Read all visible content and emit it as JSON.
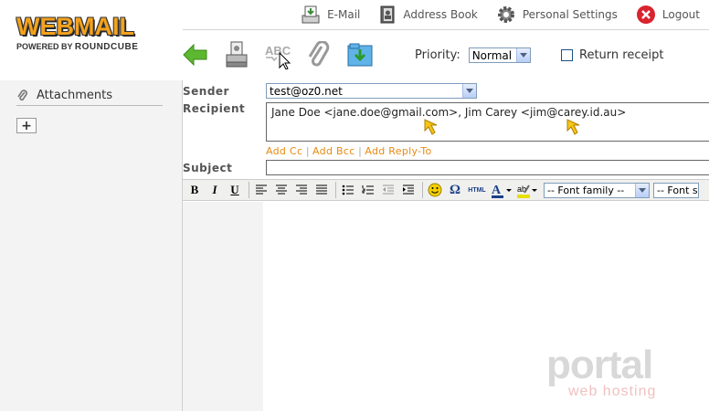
{
  "logo": {
    "title": "WEBMAIL",
    "powered_by": "POWERED BY",
    "brand": "ROUNDCUBE"
  },
  "topnav": [
    {
      "label": "E-Mail",
      "icon": "email-icon"
    },
    {
      "label": "Address Book",
      "icon": "address-book-icon"
    },
    {
      "label": "Personal Settings",
      "icon": "gear-icon"
    },
    {
      "label": "Logout",
      "icon": "logout-icon"
    }
  ],
  "toolbar": {
    "buttons": [
      "back-icon",
      "send-icon",
      "spellcheck-icon",
      "attach-icon",
      "save-icon"
    ],
    "spellcheck_text": "ABC",
    "priority_label": "Priority:",
    "priority_value": "Normal",
    "receipt_label": "Return receipt"
  },
  "sidebar": {
    "attachments_label": "Attachments",
    "add_label": "+"
  },
  "compose": {
    "sender_label": "Sender",
    "sender_value": "test@oz0.net",
    "recipient_label": "Recipient",
    "recipient_value": "Jane Doe <jane.doe@gmail.com>, Jim Carey <jim@carey.id.au>",
    "add_cc": "Add Cc",
    "add_bcc": "Add Bcc",
    "add_reply_to": "Add Reply-To",
    "separator": "|",
    "subject_label": "Subject",
    "subject_value": ""
  },
  "editor": {
    "bold": "B",
    "italic": "I",
    "underline": "U",
    "html_label": "HTML",
    "font_family": "-- Font family --",
    "font_size": "-- Font s"
  },
  "watermark": {
    "line1": "portal",
    "line2": "web hosting"
  },
  "colors": {
    "accent_orange": "#e88a12",
    "logo_orange": "#f4a21d",
    "logout_red": "#d9232e",
    "select_border": "#7f9db9"
  }
}
